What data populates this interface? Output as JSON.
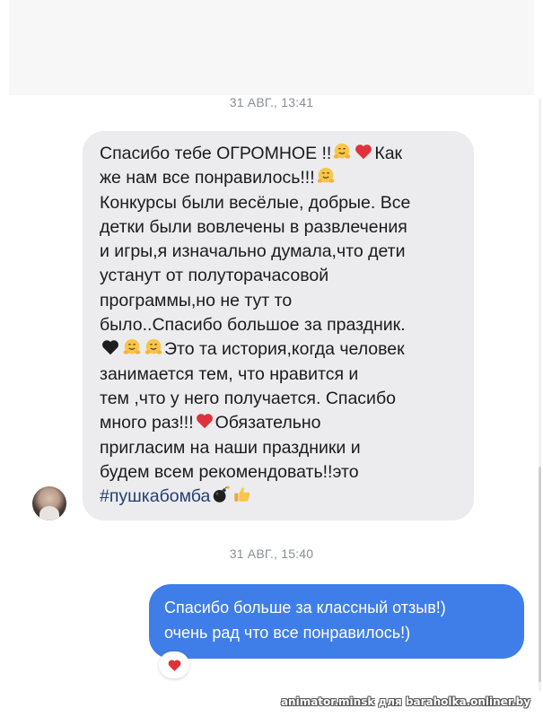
{
  "timestamps": {
    "first": "31 АВГ., 13:41",
    "second": "31 АВГ., 15:40"
  },
  "incoming": {
    "part1": "Спасибо тебе ОГРОМНОЕ !!",
    "part2": "Как\nже нам все понравилось!!!",
    "part3": "\nКонкурсы были весёлые, добрые. Все\nдетки были вовлечены в развлечения\nи игры,я изначально думала,что дети\nустанут от полуторачасовой\nпрограммы,но не тут то\nбыло..Спасибо большое за праздник.\n",
    "part4": "Это та история,когда человек\nзанимается тем, что нравится и\nтем ,что у него получается. Спасибо\nмного раз!!!",
    "part5": "Обязательно\nпригласим на наши праздники и\nбудем всем рекомендовать!!это\n",
    "hashtag": "#пушкабомба"
  },
  "outgoing": {
    "text": "Спасибо больше за классный отзыв!)\nочень рад что все понравилось!)"
  },
  "watermark": "animator.minsk для baraholka.onliner.by",
  "icons": [
    "hugging-face-emoji",
    "red-heart-emoji",
    "black-heart-emoji",
    "bomb-emoji",
    "thumbs-up-emoji",
    "avatar"
  ],
  "colors": {
    "incoming_bubble": "#ececee",
    "outgoing_bubble": "#3f7ee8",
    "hashtag": "#233f73",
    "heart": "#e0323a"
  }
}
